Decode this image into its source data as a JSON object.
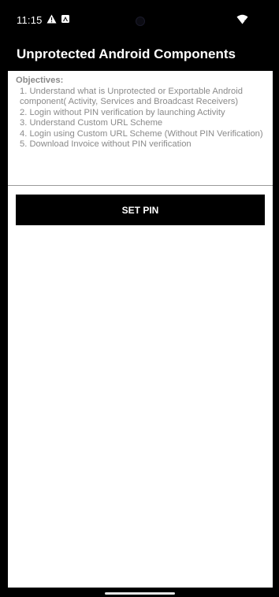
{
  "status_bar": {
    "time": "11:15",
    "icons": [
      "warning-icon",
      "a-icon",
      "camera-icon",
      "wifi-icon"
    ]
  },
  "app_bar": {
    "title": "Unprotected Android Components"
  },
  "objectives": {
    "heading": "Objectives:",
    "items": [
      "1. Understand what is Unprotected or Exportable Android component( Activity, Services and Broadcast Receivers)",
      "2. Login without PIN verification by launching Activity",
      "3. Understand Custom URL Scheme",
      "4. Login using Custom URL Scheme (Without PIN Verification)",
      "5. Download Invoice without PIN verification"
    ]
  },
  "button": {
    "set_pin_label": "SET PIN"
  },
  "colors": {
    "background": "#000000",
    "content_background": "#ffffff",
    "objectives_text": "#8a8a8a",
    "button_background": "#000000",
    "button_text": "#ffffff"
  }
}
